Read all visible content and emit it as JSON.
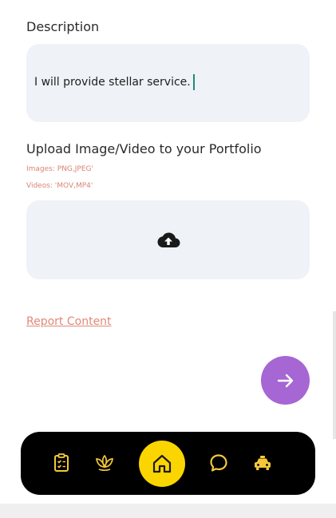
{
  "description": {
    "label": "Description",
    "value": "I will provide stellar service."
  },
  "upload": {
    "label": "Upload Image/Video to your Portfolio",
    "images_hint": "Images: PNG,JPEG'",
    "videos_hint": "Videos: 'MOV,MP4'",
    "icon": "cloud-upload-icon"
  },
  "report_link": "Report Content",
  "next_button": {
    "icon": "arrow-right-icon",
    "color": "#a666d3"
  },
  "bottom_nav": {
    "items": [
      {
        "name": "tasks",
        "icon": "clipboard-checklist-icon"
      },
      {
        "name": "wellness",
        "icon": "lotus-icon"
      },
      {
        "name": "home",
        "icon": "home-icon",
        "active": true
      },
      {
        "name": "chat",
        "icon": "chat-bubble-icon"
      },
      {
        "name": "taxi",
        "icon": "taxi-icon"
      }
    ],
    "background": "#000000",
    "icon_color": "#f3c93a",
    "active_color": "#fbd500"
  }
}
